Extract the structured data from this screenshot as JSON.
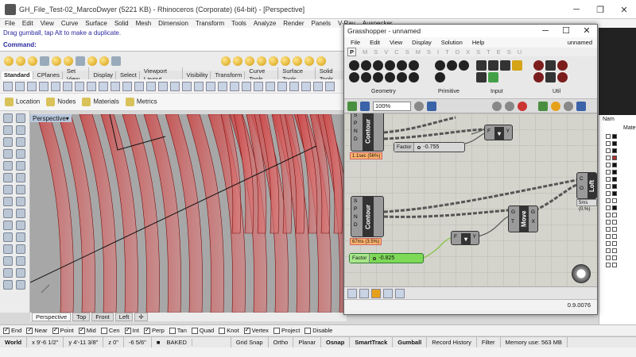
{
  "rhino": {
    "title": "GH_File_Test-02_MarcoDwyer (5221 KB) - Rhinoceros (Corporate) (64-bit) - [Perspective]",
    "menu": [
      "File",
      "Edit",
      "View",
      "Curve",
      "Surface",
      "Solid",
      "Mesh",
      "Dimension",
      "Transform",
      "Tools",
      "Analyze",
      "Render",
      "Panels",
      "V-Ray",
      "Auspecker"
    ],
    "command_history": "Drag gumball, tap Alt to make a duplicate.",
    "command_prompt": "Command:",
    "tabs": [
      "Standard",
      "CPlanes",
      "Set View",
      "Display",
      "Select",
      "Viewport Layout",
      "Visibility",
      "Transform",
      "Curve Tools",
      "Surface Tools",
      "Solid Tools"
    ],
    "active_tab": "Standard",
    "panel_tabs": [
      "Location",
      "Nodes",
      "Materials",
      "Metrics"
    ],
    "viewport_label": "Perspective",
    "viewport_tabs": [
      "Perspective",
      "Top",
      "Front",
      "Left"
    ],
    "osnaps": [
      {
        "label": "End",
        "on": true
      },
      {
        "label": "Near",
        "on": true
      },
      {
        "label": "Point",
        "on": true
      },
      {
        "label": "Mid",
        "on": true
      },
      {
        "label": "Cen",
        "on": false
      },
      {
        "label": "Int",
        "on": true
      },
      {
        "label": "Perp",
        "on": true
      },
      {
        "label": "Tan",
        "on": false
      },
      {
        "label": "Quad",
        "on": false
      },
      {
        "label": "Knot",
        "on": false
      },
      {
        "label": "Vertex",
        "on": true
      },
      {
        "label": "Project",
        "on": false
      },
      {
        "label": "Disable",
        "on": false
      }
    ],
    "status": {
      "cplane": "World",
      "x": "x 9'-6 1/2\"",
      "y": "y 4'-11 3/8\"",
      "z": "z 0\"",
      "dist": "-6 5/6\"",
      "layer": "BAKED",
      "toggles": [
        "Grid Snap",
        "Ortho",
        "Planar",
        "Osnap",
        "SmartTrack",
        "Gumball",
        "Record History",
        "Filter"
      ],
      "memory": "Memory use: 563 MB"
    },
    "right_panel": {
      "tab": "Nam",
      "header": "Materi"
    }
  },
  "grasshopper": {
    "title": "Grasshopper - unnamed",
    "menu": [
      "File",
      "Edit",
      "View",
      "Display",
      "Solution",
      "Help"
    ],
    "doc_name": "unnamed",
    "categories": [
      "P",
      "M",
      "S",
      "V",
      "C",
      "S",
      "M",
      "S",
      "I",
      "T",
      "D",
      "X",
      "S",
      "T",
      "E",
      "S",
      "U"
    ],
    "groups": [
      "Geometry",
      "Primitive",
      "Input",
      "Util"
    ],
    "zoom": "100%",
    "status_version": "0.9.0076",
    "components": {
      "contour1": "Contour",
      "contour2": "Contour",
      "move": "Move",
      "loft": "Loft",
      "contour1_timing": "1.1sec (56%)",
      "contour2_timing": "67ms (3.5%)",
      "loft_timing": "5ms (0.%)"
    },
    "sliders": [
      {
        "label": "Factor",
        "value": "-0.755"
      },
      {
        "label": "Factor",
        "value": "-0.825"
      }
    ]
  }
}
